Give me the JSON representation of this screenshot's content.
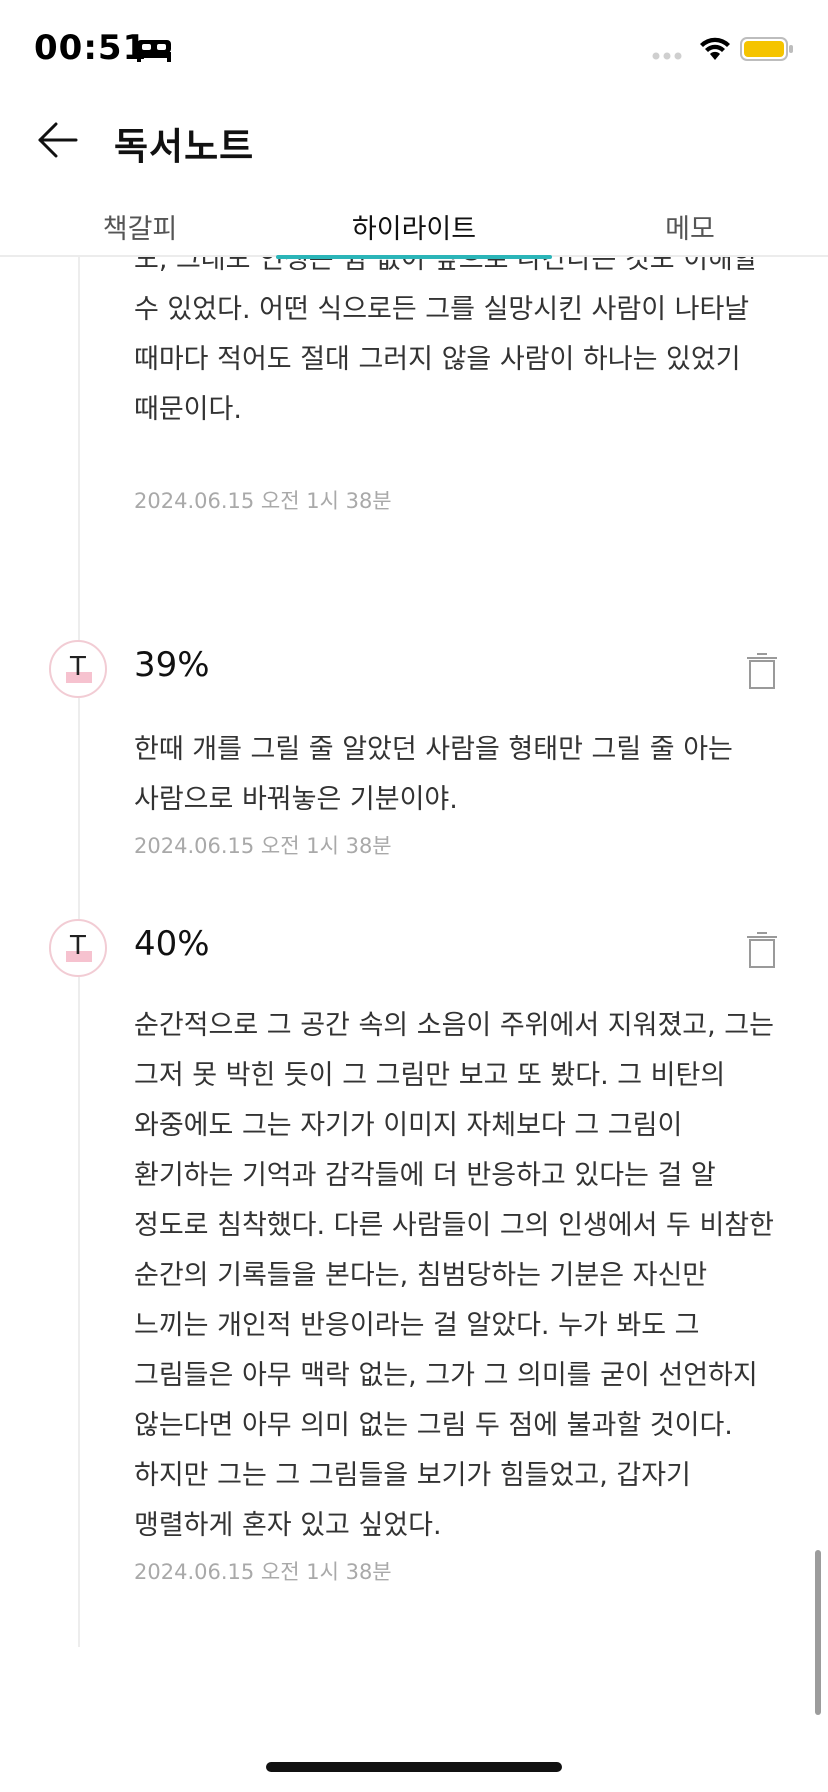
{
  "status_bar": {
    "time": "00:51"
  },
  "header": {
    "title": "독서노트"
  },
  "tabs": [
    {
      "label": "책갈피",
      "active": false
    },
    {
      "label": "하이라이트",
      "active": true
    },
    {
      "label": "메모",
      "active": false
    }
  ],
  "colors": {
    "accent": "#2bb5b8",
    "highlight_marker": "#f6c2cf",
    "battery": "#f5c400"
  },
  "entries": [
    {
      "text": "도, 그래도 인생은 쉼 없이 앞으로 나간다는 것도 이해할 수 있었다. 어떤 식으로든 그를 실망시킨 사람이 나타날 때마다 적어도 절대 그러지 않을 사람이 하나는 있었기 때문이다.",
      "date": "2024.06.15 오전 1시 38분"
    },
    {
      "percent": "39%",
      "marker_icon": "T",
      "text": "한때 개를 그릴 줄 알았던 사람을 형태만 그릴 줄 아는 사람으로 바꿔놓은 기분이야.",
      "date": "2024.06.15 오전 1시 38분"
    },
    {
      "percent": "40%",
      "marker_icon": "T",
      "text": "순간적으로 그 공간 속의 소음이 주위에서 지워졌고, 그는 그저 못 박힌 듯이 그 그림만 보고 또 봤다. 그 비탄의 와중에도 그는 자기가 이미지 자체보다 그 그림이 환기하는 기억과 감각들에 더 반응하고 있다는 걸 알 정도로 침착했다. 다른 사람들이 그의 인생에서 두 비참한 순간의 기록들을 본다는, 침범당하는 기분은 자신만 느끼는 개인적 반응이라는 걸 알았다. 누가 봐도 그 그림들은 아무 맥락 없는, 그가 그 의미를 굳이 선언하지 않는다면 아무 의미 없는 그림 두 점에 불과할 것이다. 하지만 그는 그 그림들을 보기가 힘들었고, 갑자기 맹렬하게 혼자 있고 싶었다.",
      "date": "2024.06.15 오전 1시 38분"
    }
  ]
}
